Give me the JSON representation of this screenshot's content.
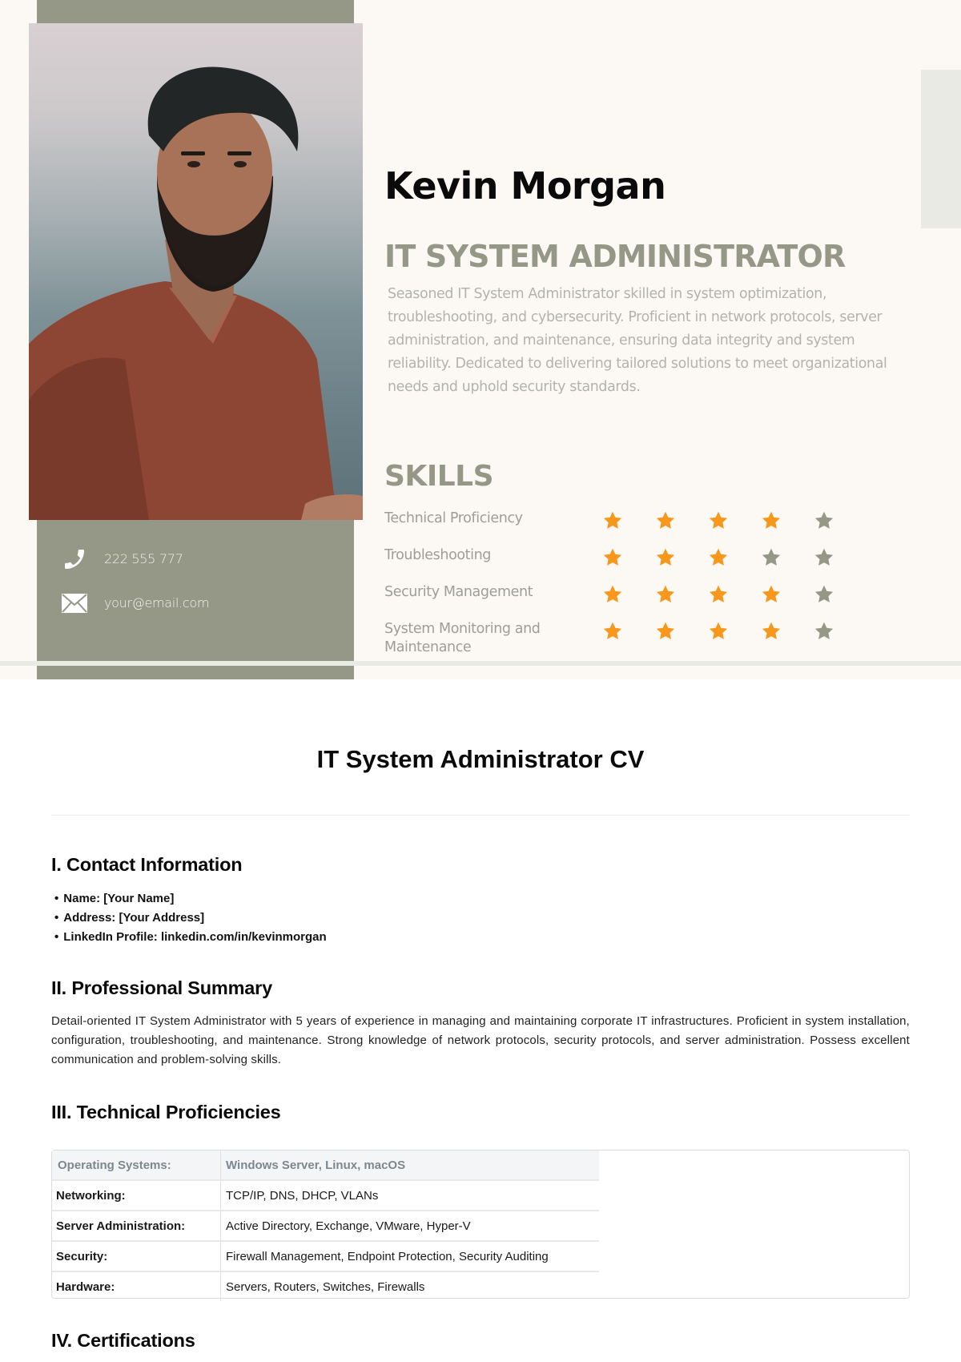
{
  "profile": {
    "name": "Kevin Morgan",
    "title": "IT SYSTEM ADMINISTRATOR",
    "bio": "Seasoned IT System Administrator skilled in system optimization, troubleshooting, and cybersecurity. Proficient in network protocols, server administration, and maintenance, ensuring data integrity and system reliability. Dedicated to delivering tailored solutions to meet organizational needs and uphold security standards.",
    "photo_alt": "Portrait photo of a bearded man in a rust-colored t-shirt",
    "contact": {
      "phone": "222 555 777",
      "phone_icon": "phone-icon",
      "email": "your@email.com",
      "email_icon": "envelope-icon"
    }
  },
  "skills": {
    "heading": "SKILLS",
    "max_rating": 5,
    "items": [
      {
        "label": "Technical Proficiency",
        "rating": 4
      },
      {
        "label": "Troubleshooting",
        "rating": 3
      },
      {
        "label": "Security Management",
        "rating": 4
      },
      {
        "label": "System Monitoring and Maintenance",
        "rating": 4
      }
    ]
  },
  "colors": {
    "sage": "#959887",
    "cream": "#fcf9f5",
    "star_filled": "#f7981d",
    "star_empty": "#959887"
  },
  "document": {
    "title": "IT System Administrator CV",
    "sections": {
      "contact": {
        "heading": "I. Contact Information",
        "items": [
          "Name: [Your Name]",
          "Address: [Your Address]",
          "LinkedIn Profile: linkedin.com/in/kevinmorgan"
        ]
      },
      "summary": {
        "heading": "II. Professional Summary",
        "text": "Detail-oriented IT System Administrator with 5 years of experience in managing and maintaining corporate IT infrastructures. Proficient in system installation, configuration, troubleshooting, and maintenance. Strong knowledge of network protocols, security protocols, and server administration. Possess excellent communication and problem-solving skills."
      },
      "technical": {
        "heading": "III. Technical Proficiencies",
        "rows": [
          {
            "key": "Operating Systems:",
            "value": "Windows Server, Linux, macOS"
          },
          {
            "key": "Networking:",
            "value": "TCP/IP, DNS, DHCP, VLANs"
          },
          {
            "key": "Server Administration:",
            "value": "Active Directory, Exchange, VMware, Hyper-V"
          },
          {
            "key": "Security:",
            "value": "Firewall Management, Endpoint Protection, Security Auditing"
          },
          {
            "key": "Hardware:",
            "value": "Servers, Routers, Switches, Firewalls"
          }
        ]
      },
      "certifications": {
        "heading": "IV. Certifications"
      }
    }
  }
}
